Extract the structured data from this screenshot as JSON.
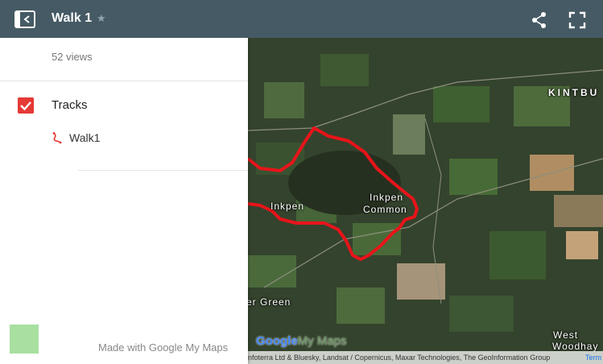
{
  "header": {
    "title": "Walk 1",
    "icons": {
      "collapse": "panel-collapse-icon",
      "star": "star-icon",
      "share": "share-icon",
      "fullscreen": "fullscreen-icon"
    },
    "background_color": "#455a64"
  },
  "panel": {
    "views": "52 views",
    "layer": {
      "title": "Tracks",
      "checked": true,
      "checkbox_color": "#e53935",
      "items": [
        {
          "label": "Walk1",
          "icon": "route-icon",
          "color": "#e53935"
        }
      ]
    },
    "footer": "Made with Google My Maps"
  },
  "map": {
    "labels": {
      "kintbury": "KINTBU",
      "inkpen": "Inkpen",
      "inkpen_common_1": "Inkpen",
      "inkpen_common_2": "Common",
      "green": "er Green",
      "west": "West",
      "woodhay": "Woodhay"
    },
    "logo_google": "Google",
    "logo_mymaps": "My Maps",
    "attribution": "nfoterra Ltd & Bluesky, Landsat / Copernicus, Maxar Technologies, The GeoInformation Group",
    "terms": "Term",
    "track_color": "#e8141a"
  }
}
